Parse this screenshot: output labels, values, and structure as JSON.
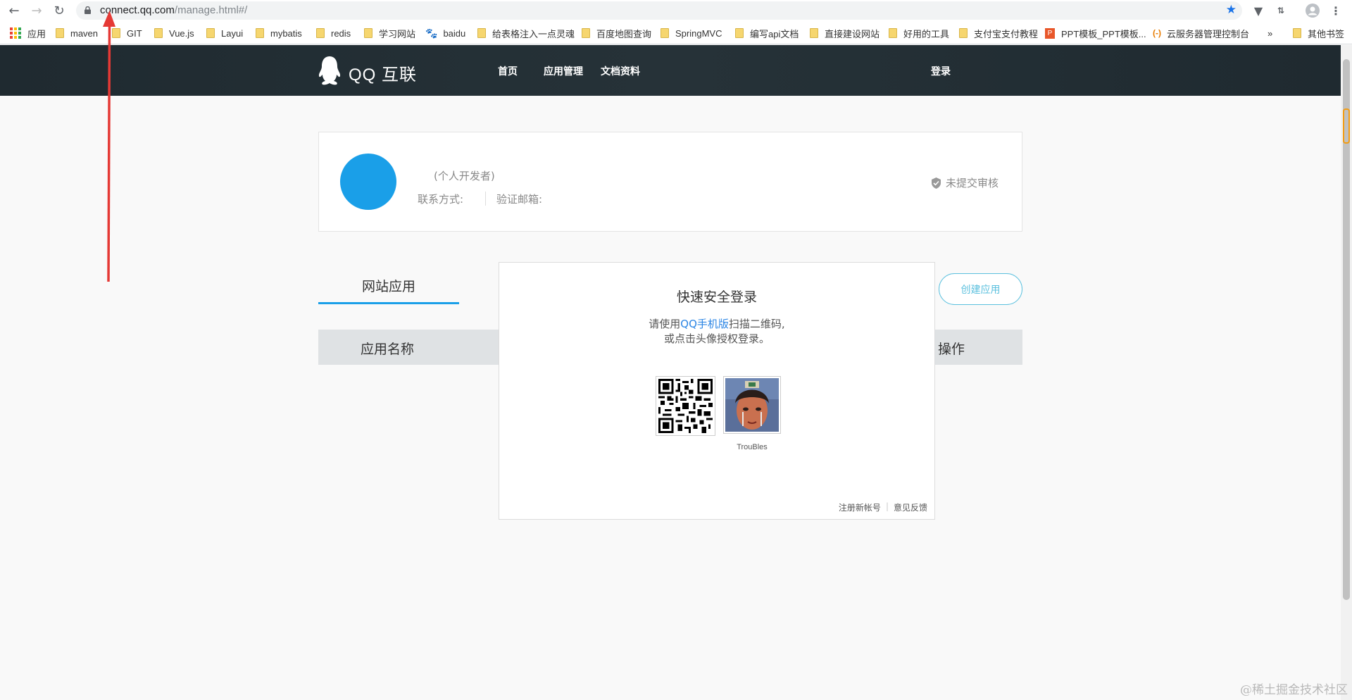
{
  "browser": {
    "url_host": "connect.qq.com",
    "url_path": "/manage.html#/",
    "bookmarks": [
      {
        "label": "应用",
        "icon": "apps-grid-icon"
      },
      {
        "label": "maven",
        "icon": "folder-icon"
      },
      {
        "label": "GIT",
        "icon": "folder-icon"
      },
      {
        "label": "Vue.js",
        "icon": "folder-icon"
      },
      {
        "label": "Layui",
        "icon": "folder-icon"
      },
      {
        "label": "mybatis",
        "icon": "folder-icon"
      },
      {
        "label": "redis",
        "icon": "folder-icon"
      },
      {
        "label": "学习网站",
        "icon": "folder-icon"
      },
      {
        "label": "baidu",
        "icon": "baidu-paw-icon"
      },
      {
        "label": "给表格注入一点灵魂",
        "icon": "folder-icon"
      },
      {
        "label": "百度地图查询",
        "icon": "folder-icon"
      },
      {
        "label": "SpringMVC",
        "icon": "folder-icon"
      },
      {
        "label": "编写api文档",
        "icon": "folder-icon"
      },
      {
        "label": "直接建设网站",
        "icon": "folder-icon"
      },
      {
        "label": "好用的工具",
        "icon": "folder-icon"
      },
      {
        "label": "支付宝支付教程",
        "icon": "folder-icon"
      },
      {
        "label": "PPT模板_PPT模板...",
        "icon": "ppt-icon"
      },
      {
        "label": "云服务器管理控制台",
        "icon": "cloud-icon"
      },
      {
        "label": "其他书签",
        "icon": "folder-icon"
      }
    ],
    "more_bookmarks": "»"
  },
  "header": {
    "logo_text": "QQ 互联",
    "nav": [
      "首页",
      "应用管理",
      "文档资料"
    ],
    "login": "登录"
  },
  "profile": {
    "dev_type": "(个人开发者)",
    "contact_label": "联系方式:",
    "email_label": "验证邮箱:",
    "review_status": "未提交审核"
  },
  "apps": {
    "tab_label": "网站应用",
    "create_button": "创建应用",
    "columns": {
      "name": "应用名称",
      "action": "操作"
    }
  },
  "login_modal": {
    "title": "快速安全登录",
    "line1_prefix": "请使用",
    "line1_link": "QQ手机版",
    "line1_suffix": "扫描二维码,",
    "line2": "或点击头像授权登录。",
    "user_name": "TrouBles",
    "register": "注册新帐号",
    "separator": "|",
    "feedback": "意见反馈"
  },
  "watermark": "@稀土掘金技术社区",
  "colors": {
    "accent": "#1a9fe8",
    "header_bg": "#263238",
    "create_btn": "#5bc0de",
    "qq_link": "#2b85e4",
    "annotation_arrow": "#e53935"
  }
}
